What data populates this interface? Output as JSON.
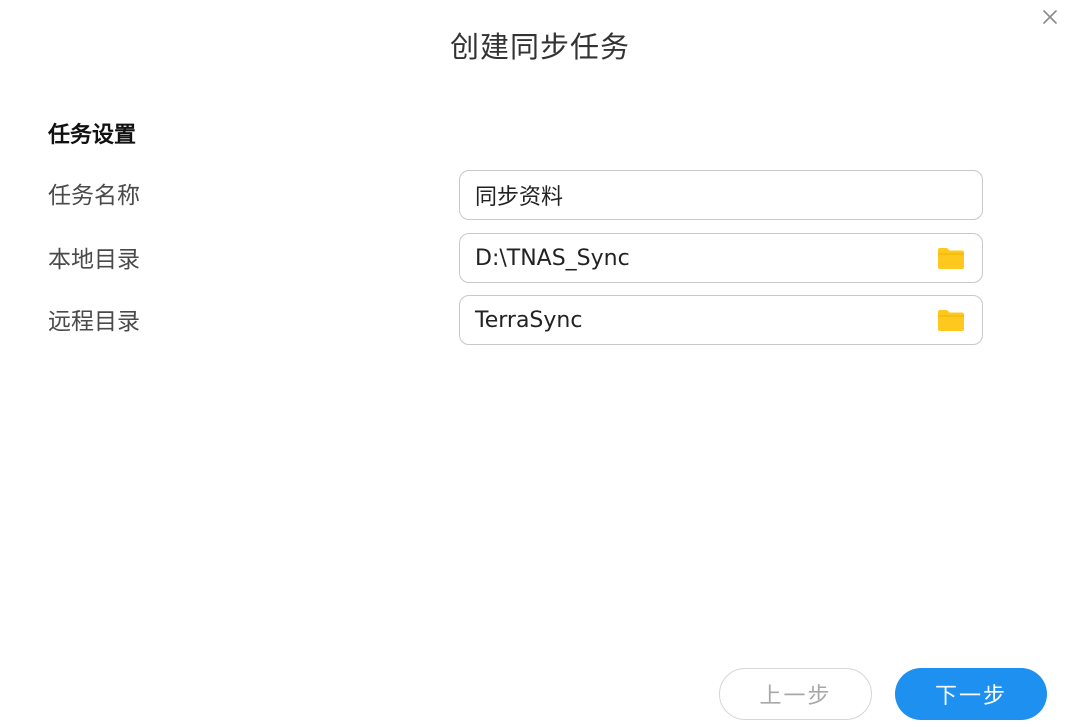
{
  "dialog": {
    "title": "创建同步任务",
    "close_icon": "close-icon"
  },
  "section": {
    "title": "任务设置"
  },
  "fields": [
    {
      "label": "任务名称",
      "value": "同步资料",
      "has_folder_button": false
    },
    {
      "label": "本地目录",
      "value": "D:\\TNAS_Sync",
      "has_folder_button": true,
      "icon": "folder-icon"
    },
    {
      "label": "远程目录",
      "value": "TerraSync",
      "has_folder_button": true,
      "icon": "folder-icon"
    }
  ],
  "buttons": {
    "prev_label": "上一步",
    "next_label": "下一步"
  },
  "colors": {
    "primary": "#1e90f0",
    "folder": "#ffc81e",
    "border": "#c8c8c8"
  }
}
